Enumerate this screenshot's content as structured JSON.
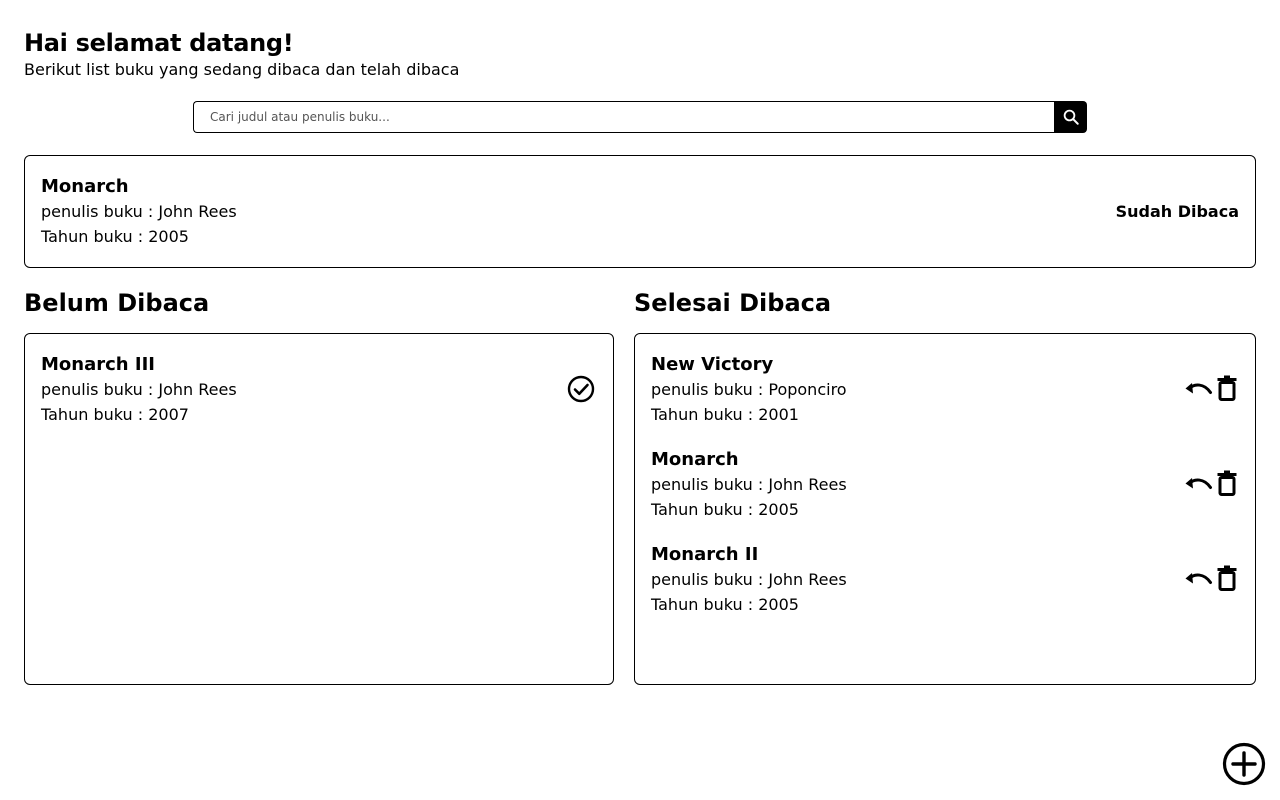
{
  "header": {
    "title": "Hai selamat datang!",
    "subtitle": "Berikut list buku yang sedang dibaca dan telah dibaca"
  },
  "search": {
    "placeholder": "Cari judul atau penulis buku...",
    "icon": "search-icon"
  },
  "featured": {
    "title": "Monarch",
    "author": "penulis buku : John Rees",
    "year": "Tahun buku : 2005",
    "status": "Sudah Dibaca"
  },
  "unread": {
    "heading": "Belum Dibaca",
    "books": [
      {
        "title": "Monarch III",
        "author": "penulis buku : John Rees",
        "year": "Tahun buku : 2007",
        "icon": "check-circle-icon"
      }
    ]
  },
  "done": {
    "heading": "Selesai Dibaca",
    "books": [
      {
        "title": "New Victory",
        "author": "penulis buku : Poponciro",
        "year": "Tahun buku : 2001",
        "icons": [
          "undo-icon",
          "trash-icon"
        ]
      },
      {
        "title": "Monarch",
        "author": "penulis buku : John Rees",
        "year": "Tahun buku : 2005",
        "icons": [
          "undo-icon",
          "trash-icon"
        ]
      },
      {
        "title": "Monarch II",
        "author": "penulis buku : John Rees",
        "year": "Tahun buku : 2005",
        "icons": [
          "undo-icon",
          "trash-icon"
        ]
      }
    ]
  },
  "fab": {
    "icon": "add-circle-icon"
  }
}
